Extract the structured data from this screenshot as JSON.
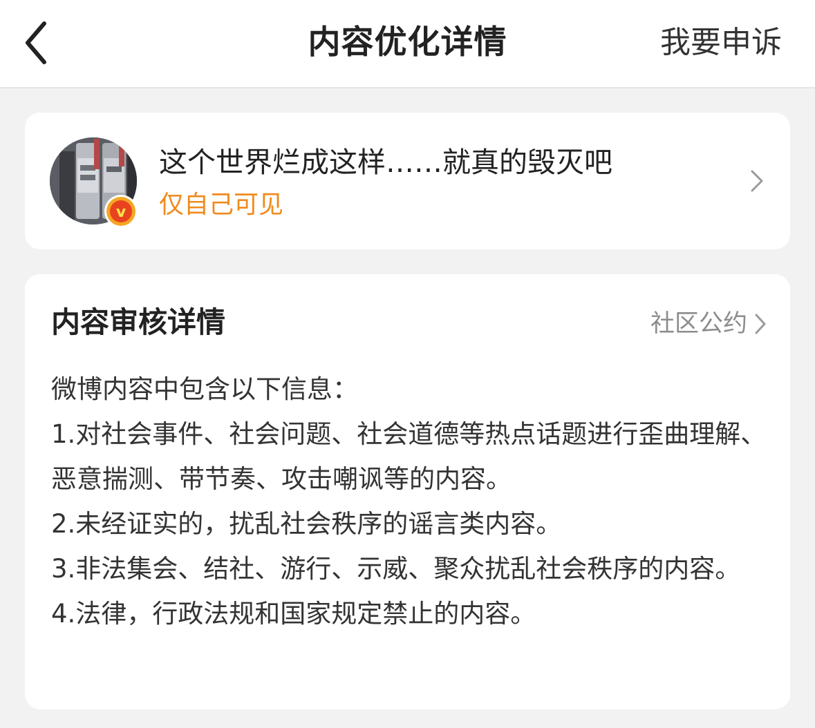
{
  "nav": {
    "back_icon": "chevron-left-icon",
    "title": "内容优化详情",
    "appeal_label": "我要申诉"
  },
  "post": {
    "text": "这个世界烂成这样……就真的毁灭吧",
    "visibility": "仅自己可见",
    "badge_letter": "v",
    "chevron_icon": "chevron-right-icon"
  },
  "review": {
    "title": "内容审核详情",
    "convention_label": "社区公约",
    "intro": "微博内容中包含以下信息：",
    "items": [
      "1.对社会事件、社会问题、社会道德等热点话题进行歪曲理解、恶意揣测、带节奏、攻击嘲讽等的内容。",
      "2.未经证实的，扰乱社会秩序的谣言类内容。",
      "3.非法集会、结社、游行、示威、聚众扰乱社会秩序的内容。",
      "4.法律，行政法规和国家规定禁止的内容。"
    ]
  },
  "colors": {
    "accent_orange": "#f08a1d",
    "page_bg": "#f2f2f2",
    "card_bg": "#ffffff",
    "muted_text": "#8c8c8c"
  }
}
